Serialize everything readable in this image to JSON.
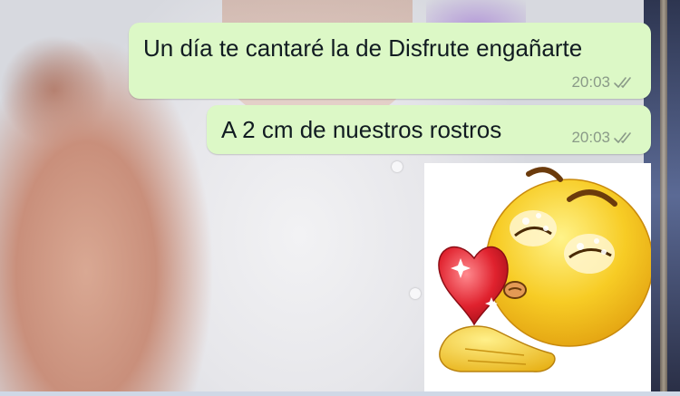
{
  "chat": {
    "messages": [
      {
        "text": "Un día te cantaré la de Disfrute engañarte",
        "time": "20:03",
        "status_icon": "double-check-icon"
      },
      {
        "text": "A 2 cm de nuestros rostros",
        "time": "20:03",
        "status_icon": "double-check-icon"
      }
    ],
    "sticker": {
      "icon": "kissing-emoji-heart-sticker"
    }
  },
  "colors": {
    "bubble_outgoing": "#dcf8c6",
    "meta_text": "#8a9a88",
    "emoji_yellow": "#f4c21a",
    "heart_red": "#e0222e"
  }
}
